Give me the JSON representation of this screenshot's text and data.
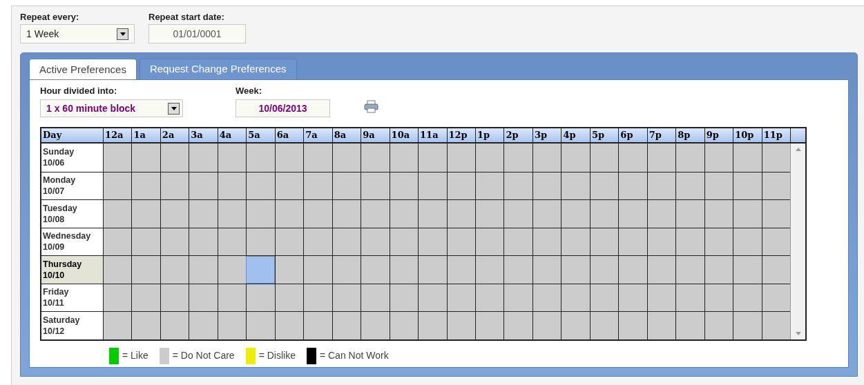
{
  "repeat_every": {
    "label": "Repeat every:",
    "value": "1 Week"
  },
  "repeat_start_date": {
    "label": "Repeat start date:",
    "value": "01/01/0001"
  },
  "tabs": [
    {
      "label": "Active Preferences",
      "selected": true
    },
    {
      "label": "Request Change Preferences",
      "selected": false
    }
  ],
  "hour_divided_into": {
    "label": "Hour divided into:",
    "value": "1 x 60 minute block"
  },
  "week": {
    "label": "Week:",
    "value": "10/06/2013"
  },
  "table": {
    "columns": [
      "Day",
      "12a",
      "1a",
      "2a",
      "3a",
      "4a",
      "5a",
      "6a",
      "7a",
      "8a",
      "9a",
      "10a",
      "11a",
      "12p",
      "1p",
      "2p",
      "3p",
      "4p",
      "5p",
      "6p",
      "7p",
      "8p",
      "9p",
      "10p",
      "11p"
    ],
    "rows": [
      {
        "day": "Sunday",
        "date": "10/06",
        "selected": false,
        "cells": [
          {
            "selected": false
          },
          {
            "selected": false
          },
          {
            "selected": false
          },
          {
            "selected": false
          },
          {
            "selected": false
          },
          {
            "selected": false
          },
          {
            "selected": false
          },
          {
            "selected": false
          },
          {
            "selected": false
          },
          {
            "selected": false
          },
          {
            "selected": false
          },
          {
            "selected": false
          },
          {
            "selected": false
          },
          {
            "selected": false
          },
          {
            "selected": false
          },
          {
            "selected": false
          },
          {
            "selected": false
          },
          {
            "selected": false
          },
          {
            "selected": false
          },
          {
            "selected": false
          },
          {
            "selected": false
          },
          {
            "selected": false
          },
          {
            "selected": false
          },
          {
            "selected": false
          }
        ]
      },
      {
        "day": "Monday",
        "date": "10/07",
        "selected": false,
        "cells": [
          {
            "selected": false
          },
          {
            "selected": false
          },
          {
            "selected": false
          },
          {
            "selected": false
          },
          {
            "selected": false
          },
          {
            "selected": false
          },
          {
            "selected": false
          },
          {
            "selected": false
          },
          {
            "selected": false
          },
          {
            "selected": false
          },
          {
            "selected": false
          },
          {
            "selected": false
          },
          {
            "selected": false
          },
          {
            "selected": false
          },
          {
            "selected": false
          },
          {
            "selected": false
          },
          {
            "selected": false
          },
          {
            "selected": false
          },
          {
            "selected": false
          },
          {
            "selected": false
          },
          {
            "selected": false
          },
          {
            "selected": false
          },
          {
            "selected": false
          },
          {
            "selected": false
          }
        ]
      },
      {
        "day": "Tuesday",
        "date": "10/08",
        "selected": false,
        "cells": [
          {
            "selected": false
          },
          {
            "selected": false
          },
          {
            "selected": false
          },
          {
            "selected": false
          },
          {
            "selected": false
          },
          {
            "selected": false
          },
          {
            "selected": false
          },
          {
            "selected": false
          },
          {
            "selected": false
          },
          {
            "selected": false
          },
          {
            "selected": false
          },
          {
            "selected": false
          },
          {
            "selected": false
          },
          {
            "selected": false
          },
          {
            "selected": false
          },
          {
            "selected": false
          },
          {
            "selected": false
          },
          {
            "selected": false
          },
          {
            "selected": false
          },
          {
            "selected": false
          },
          {
            "selected": false
          },
          {
            "selected": false
          },
          {
            "selected": false
          },
          {
            "selected": false
          }
        ]
      },
      {
        "day": "Wednesday",
        "date": "10/09",
        "selected": false,
        "cells": [
          {
            "selected": false
          },
          {
            "selected": false
          },
          {
            "selected": false
          },
          {
            "selected": false
          },
          {
            "selected": false
          },
          {
            "selected": false
          },
          {
            "selected": false
          },
          {
            "selected": false
          },
          {
            "selected": false
          },
          {
            "selected": false
          },
          {
            "selected": false
          },
          {
            "selected": false
          },
          {
            "selected": false
          },
          {
            "selected": false
          },
          {
            "selected": false
          },
          {
            "selected": false
          },
          {
            "selected": false
          },
          {
            "selected": false
          },
          {
            "selected": false
          },
          {
            "selected": false
          },
          {
            "selected": false
          },
          {
            "selected": false
          },
          {
            "selected": false
          },
          {
            "selected": false
          }
        ]
      },
      {
        "day": "Thursday",
        "date": "10/10",
        "selected": true,
        "cells": [
          {
            "selected": false
          },
          {
            "selected": false
          },
          {
            "selected": false
          },
          {
            "selected": false
          },
          {
            "selected": false
          },
          {
            "selected": true
          },
          {
            "selected": false
          },
          {
            "selected": false
          },
          {
            "selected": false
          },
          {
            "selected": false
          },
          {
            "selected": false
          },
          {
            "selected": false
          },
          {
            "selected": false
          },
          {
            "selected": false
          },
          {
            "selected": false
          },
          {
            "selected": false
          },
          {
            "selected": false
          },
          {
            "selected": false
          },
          {
            "selected": false
          },
          {
            "selected": false
          },
          {
            "selected": false
          },
          {
            "selected": false
          },
          {
            "selected": false
          },
          {
            "selected": false
          }
        ]
      },
      {
        "day": "Friday",
        "date": "10/11",
        "selected": false,
        "cells": [
          {
            "selected": false
          },
          {
            "selected": false
          },
          {
            "selected": false
          },
          {
            "selected": false
          },
          {
            "selected": false
          },
          {
            "selected": false
          },
          {
            "selected": false
          },
          {
            "selected": false
          },
          {
            "selected": false
          },
          {
            "selected": false
          },
          {
            "selected": false
          },
          {
            "selected": false
          },
          {
            "selected": false
          },
          {
            "selected": false
          },
          {
            "selected": false
          },
          {
            "selected": false
          },
          {
            "selected": false
          },
          {
            "selected": false
          },
          {
            "selected": false
          },
          {
            "selected": false
          },
          {
            "selected": false
          },
          {
            "selected": false
          },
          {
            "selected": false
          },
          {
            "selected": false
          }
        ]
      },
      {
        "day": "Saturday",
        "date": "10/12",
        "selected": false,
        "cells": [
          {
            "selected": false
          },
          {
            "selected": false
          },
          {
            "selected": false
          },
          {
            "selected": false
          },
          {
            "selected": false
          },
          {
            "selected": false
          },
          {
            "selected": false
          },
          {
            "selected": false
          },
          {
            "selected": false
          },
          {
            "selected": false
          },
          {
            "selected": false
          },
          {
            "selected": false
          },
          {
            "selected": false
          },
          {
            "selected": false
          },
          {
            "selected": false
          },
          {
            "selected": false
          },
          {
            "selected": false
          },
          {
            "selected": false
          },
          {
            "selected": false
          },
          {
            "selected": false
          },
          {
            "selected": false
          },
          {
            "selected": false
          },
          {
            "selected": false
          },
          {
            "selected": false
          }
        ]
      }
    ]
  },
  "legend": [
    {
      "label": "= Like",
      "color": "#00cc00"
    },
    {
      "label": "= Do Not Care",
      "color": "#cccccc"
    },
    {
      "label": "= Dislike",
      "color": "#eeee00"
    },
    {
      "label": "= Can Not Work",
      "color": "#000000"
    }
  ]
}
